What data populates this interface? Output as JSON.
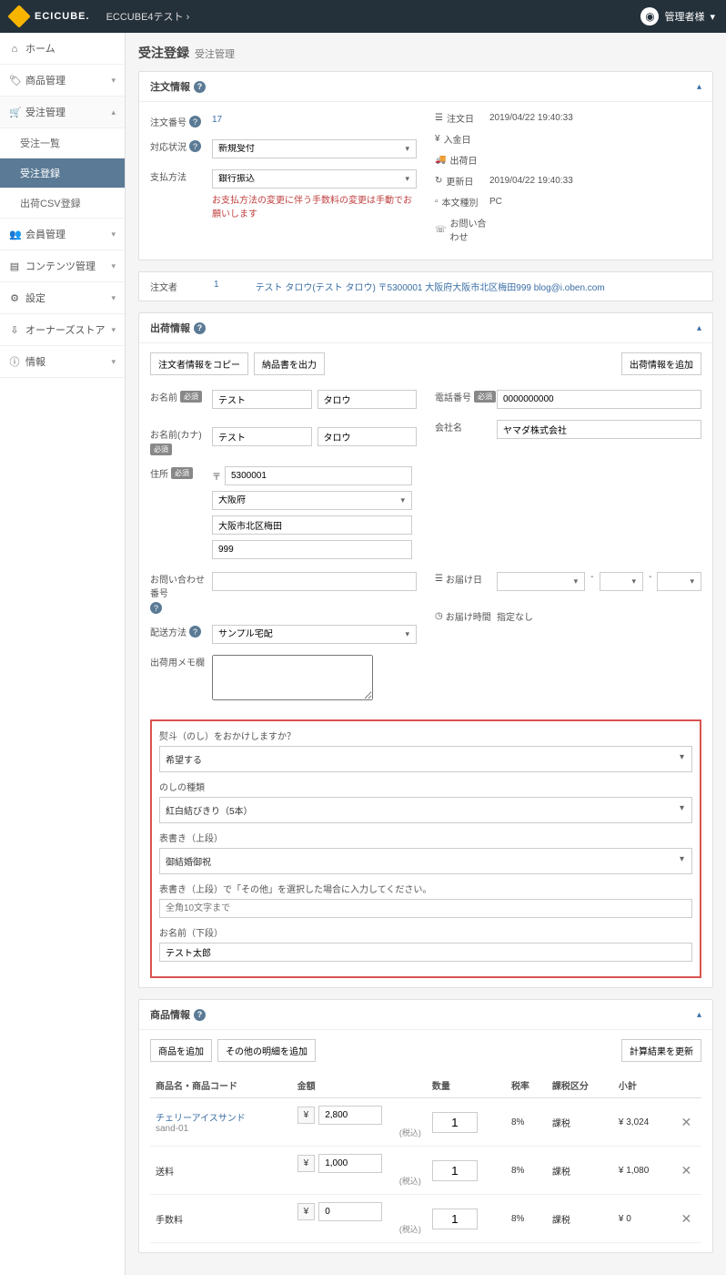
{
  "brand": "ECICUBE.",
  "breadcrumb": "ECCUBE4テスト",
  "user": "管理者様",
  "nav": {
    "home": "ホーム",
    "products": "商品管理",
    "orders": "受注管理",
    "orderList": "受注一覧",
    "orderReg": "受注登録",
    "csv": "出荷CSV登録",
    "members": "会員管理",
    "contents": "コンテンツ管理",
    "settings": "設定",
    "owners": "オーナーズストア",
    "info": "情報"
  },
  "page": {
    "title": "受注登録",
    "sub": "受注管理"
  },
  "orderInfo": {
    "heading": "注文情報",
    "orderNoLbl": "注文番号",
    "orderNo": "17",
    "statusLbl": "対応状況",
    "status": "新規受付",
    "payLbl": "支払方法",
    "pay": "銀行振込",
    "payWarn": "お支払方法の変更に伴う手数料の変更は手動でお願いします",
    "orderDateLbl": "注文日",
    "orderDate": "2019/04/22 19:40:33",
    "payDateLbl": "入金日",
    "shipDateLbl": "出荷日",
    "updateLbl": "更新日",
    "update": "2019/04/22 19:40:33",
    "deviceLbl": "本文種別",
    "device": "PC",
    "contactLbl": "お問い合わせ"
  },
  "orderer": {
    "lbl": "注文者",
    "id": "1",
    "text": "テスト タロウ(テスト タロウ) 〒5300001 大阪府大阪市北区梅田999 blog@i.oben.com"
  },
  "ship": {
    "heading": "出荷情報",
    "btnCopy": "注文者情報をコピー",
    "btnClear": "納品書を出力",
    "btnAdd": "出荷情報を追加",
    "nameLbl": "お名前",
    "name1": "テスト",
    "name2": "タロウ",
    "kanaLbl": "お名前(カナ)",
    "kana1": "テスト",
    "kana2": "タロウ",
    "telLbl": "電話番号",
    "tel": "0000000000",
    "companyLbl": "会社名",
    "company": "ヤマダ株式会社",
    "addrLbl": "住所",
    "zip": "5300001",
    "pref": "大阪府",
    "addr1": "大阪市北区梅田",
    "addr2": "999",
    "trackLbl": "お問い合わせ番号",
    "delivDateLbl": "お届け日",
    "delivTimeLbl": "お届け時間",
    "delivTime": "指定なし",
    "delivMethodLbl": "配送方法",
    "delivMethod": "サンプル宅配",
    "memoLbl": "出荷用メモ欄",
    "noshiQLbl": "熨斗（のし）をおかけしますか？",
    "noshiQ": "希望する",
    "noshiTypeLbl": "のしの種類",
    "noshiType": "紅白結びきり（5本）",
    "upperLbl": "表書き（上段）",
    "upper": "御結婚御祝",
    "upperOtherLbl": "表書き（上段）で「その他」を選択した場合に入力してください。",
    "upperOtherPh": "全角10文字まで",
    "lowerLbl": "お名前（下段）",
    "lower": "テスト太郎"
  },
  "prod": {
    "heading": "商品情報",
    "btnAdd": "商品を追加",
    "btnAddOther": "その他の明細を追加",
    "btnRecalc": "計算結果を更新",
    "h": {
      "name": "商品名・商品コード",
      "amount": "金額",
      "qty": "数量",
      "rate": "税率",
      "tax": "課税区分",
      "sub": "小計"
    },
    "rows": [
      {
        "name": "チェリーアイスサンド",
        "code": "sand-01",
        "amt": "2,800",
        "qty": "1",
        "rate": "8%",
        "tax": "課税",
        "sub": "¥ 3,024"
      },
      {
        "name": "送料",
        "code": "",
        "amt": "1,000",
        "qty": "1",
        "rate": "8%",
        "tax": "課税",
        "sub": "¥ 1,080"
      },
      {
        "name": "手数料",
        "code": "",
        "amt": "0",
        "qty": "1",
        "rate": "8%",
        "tax": "課税",
        "sub": "¥ 0"
      }
    ],
    "incl": "(税込)"
  }
}
